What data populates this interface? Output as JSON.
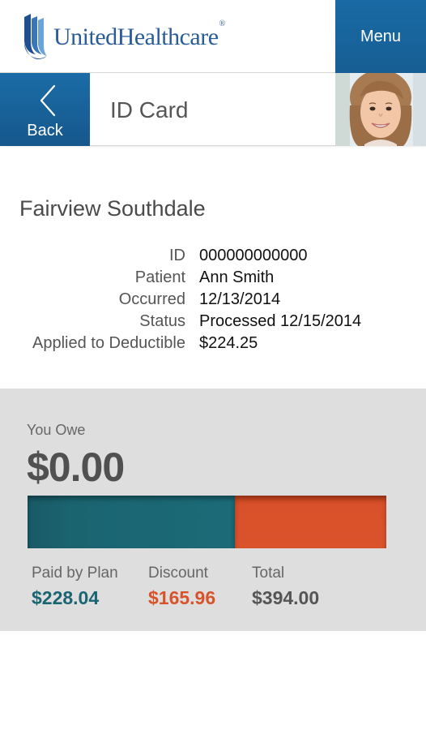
{
  "header": {
    "brand_name": "UnitedHealthcare",
    "brand_mark": "®",
    "menu_label": "Menu"
  },
  "subheader": {
    "back_label": "Back",
    "title": "ID Card"
  },
  "claim": {
    "provider": "Fairview Southdale",
    "details": [
      {
        "label": "ID",
        "value": "000000000000"
      },
      {
        "label": "Patient",
        "value": "Ann Smith"
      },
      {
        "label": "Occurred",
        "value": "12/13/2014"
      },
      {
        "label": "Status",
        "value": "Processed 12/15/2014"
      },
      {
        "label": "Applied to Deductible",
        "value": "$224.25"
      }
    ]
  },
  "summary": {
    "you_owe_label": "You Owe",
    "you_owe_amount": "$0.00",
    "breakdown": [
      {
        "label": "Paid by Plan",
        "amount": "$228.04",
        "value": 228.04,
        "color": "#1b6472"
      },
      {
        "label": "Discount",
        "amount": "$165.96",
        "value": 165.96,
        "color": "#d9532a"
      },
      {
        "label": "Total",
        "amount": "$394.00",
        "value": 394.0,
        "color": "#555555"
      }
    ]
  },
  "colors": {
    "brand_blue": "#2a5c9a",
    "nav_blue": "#1a6aa5",
    "panel_gray": "#dedede"
  },
  "icons": {
    "logo": "united-healthcare-logo-icon",
    "back": "chevron-left-icon",
    "avatar": "user-avatar-photo"
  }
}
